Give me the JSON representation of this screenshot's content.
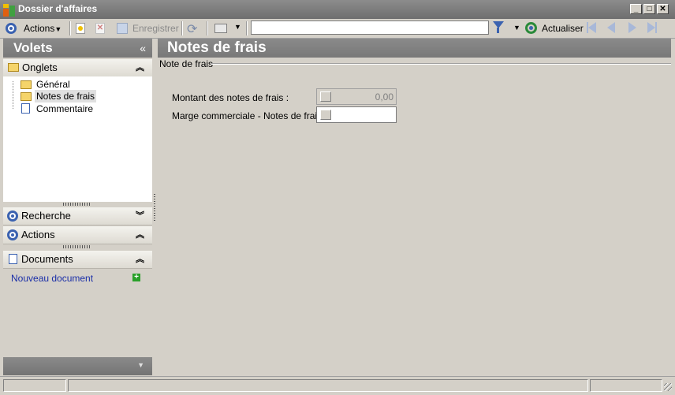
{
  "window": {
    "title": "Dossier d'affaires"
  },
  "toolbar": {
    "actions_label": "Actions",
    "save_label": "Enregistrer",
    "search_value": "",
    "refresh_label": "Actualiser"
  },
  "left": {
    "header": "Volets",
    "onglets": {
      "title": "Onglets",
      "items": [
        {
          "label": "Général",
          "icon": "folder-icon"
        },
        {
          "label": "Notes de frais",
          "icon": "folder-open-icon"
        },
        {
          "label": "Commentaire",
          "icon": "document-icon"
        }
      ]
    },
    "recherche": {
      "title": "Recherche"
    },
    "actions": {
      "title": "Actions"
    },
    "documents": {
      "title": "Documents",
      "new_document": "Nouveau document"
    }
  },
  "main": {
    "header": "Notes de frais",
    "group_title": "Note de frais",
    "fields": [
      {
        "label": "Montant des notes de frais :",
        "value": "0,00"
      },
      {
        "label": "Marge commerciale - Notes de frais :",
        "value": ""
      }
    ]
  },
  "colors": {
    "accent": "#3b62b0",
    "header_gray": "#808080",
    "link": "#1a2ea8",
    "add_green": "#2aa02a"
  }
}
